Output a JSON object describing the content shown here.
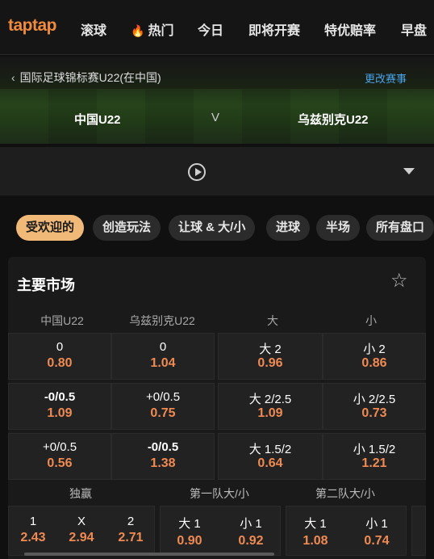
{
  "nav": {
    "logo": "taptap",
    "items": [
      "滚球",
      "热门",
      "今日",
      "即将开赛",
      "特优赔率",
      "早盘"
    ]
  },
  "match": {
    "back_label": "国际足球锦标赛U22(在中国)",
    "change_label": "更改赛事",
    "home": "中国U22",
    "vs": "V",
    "away": "乌兹别克U22"
  },
  "pills": [
    "受欢迎的",
    "创造玩法",
    "让球 & 大/小",
    "进球",
    "半场",
    "所有盘口"
  ],
  "market": {
    "title": "主要市场",
    "headers": [
      "中国U22",
      "乌兹别克U22",
      "大",
      "小"
    ],
    "rows": [
      {
        "h_line": "0",
        "h_price": "0.80",
        "a_line": "0",
        "a_price": "1.04",
        "o_line": "大 2",
        "o_price": "0.96",
        "u_line": "小 2",
        "u_price": "0.86"
      },
      {
        "h_line": "-0/0.5",
        "h_price": "1.09",
        "a_line": "+0/0.5",
        "a_price": "0.75",
        "o_line": "大 2/2.5",
        "o_price": "1.09",
        "u_line": "小 2/2.5",
        "u_price": "0.73"
      },
      {
        "h_line": "+0/0.5",
        "h_price": "0.56",
        "a_line": "-0/0.5",
        "a_price": "1.38",
        "o_line": "大 1.5/2",
        "o_price": "0.64",
        "u_line": "小 1.5/2",
        "u_price": "1.21"
      }
    ],
    "sub_headers": [
      "独赢",
      "第一队大/小",
      "第二队大/小"
    ],
    "moneyline": [
      {
        "label": "1",
        "price": "2.43"
      },
      {
        "label": "X",
        "price": "2.94"
      },
      {
        "label": "2",
        "price": "2.71"
      }
    ],
    "team1_ou": [
      {
        "label": "大 1",
        "price": "0.90"
      },
      {
        "label": "小 1",
        "price": "0.92"
      }
    ],
    "team2_ou": [
      {
        "label": "大 1",
        "price": "1.08"
      },
      {
        "label": "小 1",
        "price": "0.74"
      }
    ]
  },
  "colors": {
    "accent": "#f1b978",
    "price": "#ef8a52",
    "link": "#4aa3e8",
    "logo": "#f08a3c"
  }
}
